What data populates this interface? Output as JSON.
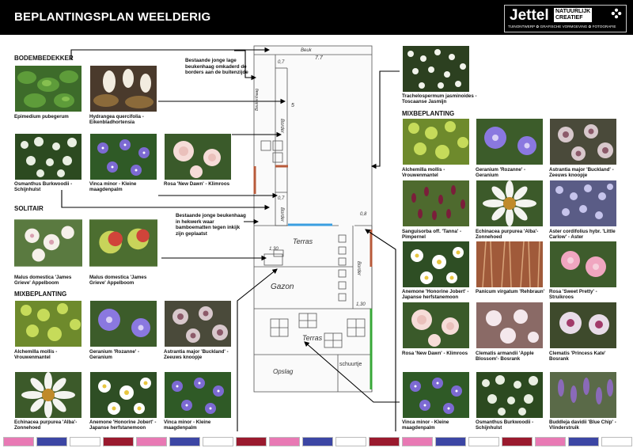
{
  "header": {
    "title": "BEPLANTINGSPLAN WEELDERIG",
    "logo_name": "Jettel",
    "logo_tag_line1": "NATUURLIJK",
    "logo_tag_line2": "CREATIEF",
    "logo_sub": "TUINONTWERP ✿ GRAFISCHE VORMGEVING ✿ FOTOGRAFIE"
  },
  "sections": {
    "ground": "BODEMBEDEKKER",
    "solitary": "SOLITAIR",
    "mix_left": "MIXBEPLANTING",
    "mix_right": "MIXBEPLANTING"
  },
  "notes": {
    "hedge_top": "Bestaande jonge lage beukenhaag omkaderd de borders aan de buitenzijde",
    "hedge_mid": "Bestaande jonge beukenhaag in hekwerk waar bamboematten tegen inkijk zijn geplaatst"
  },
  "plants": {
    "epimedium": "Epimedium pubegerum",
    "hydrangea": "Hydrangea quercifolia - Eikenbladhortensia",
    "osmanthus_l": "Osmanthus Burkwoodii - Schijnhulst",
    "vinca_l1": "Vinca minor - Kleine maagdenpalm",
    "rosa_dawn_l": "Rosa 'New Dawn' - Klimroos",
    "malus1": "Malus domestica 'James Grieve' Appelboom",
    "malus2": "Malus domestica 'James Grieve' Appelboom",
    "alch_l": "Alchemilla mollis - Vrouwenmantel",
    "gera_l": "Geranium 'Rozanne' - Geranium",
    "astr_l": "Astrantia major 'Buckland' - Zeeuws knoopje",
    "echi_l": "Echinacea purpurea 'Alba'- Zonnehoed",
    "anem_l": "Anemone 'Honorine Jobert' - Japanse herfstanemoon",
    "vinca_l2": "Vinca minor - Kleine maagdenpalm",
    "trach": "Trachelospermum jasminoides - Toscaanse Jasmijn",
    "alch_r": "Alchemilla mollis - Vrouwenmantel",
    "gera_r": "Geranium 'Rozanne' - Geranium",
    "astr_r": "Astrantia major 'Buckland' - Zeeuws knoopje",
    "sang": "Sanguisorba off. 'Tanna' - Pimpernel",
    "echi_r": "Echinacea purpurea 'Alba'- Zonnehoed",
    "aster": "Aster cordifolius hybr. 'Little Carlow' - Aster",
    "anem_r": "Anemone 'Honorine Jobert' - Japanse herfstanemoon",
    "pani": "Panicum virgatum 'Rehbraun'",
    "rosa_pretty": "Rosa 'Sweet Pretty' - Struikroos",
    "rosa_dawn_r": "Rosa 'New Dawn' - Klimroos",
    "clem_arm": "Clematis armandii 'Apple Blossom'- Bosrank",
    "clem_kate": "Clematis 'Princess Kate' Bosrank",
    "vinca_r": "Vinca minor - Kleine maagdenpalm",
    "osmanthus_r": "Osmanthus Burkwoodii - Schijnhulst",
    "buddleja": "Buddleja davidii 'Blue Chip' - Vlinderstruik"
  },
  "plan_labels": {
    "beuk_top": "Beuk",
    "dim_top": "7.7",
    "dim_07a": "0,7",
    "dim_5": "5",
    "dim_07b": "0,7",
    "dim_08": "0,8",
    "dim_130a": "1,30",
    "dim_130b": "1,30",
    "terras1": "Terras",
    "terras2": "Terras",
    "gazon": "Gazon",
    "opslag": "Opslag",
    "schuurtje": "schuurtje",
    "border_top": "Border",
    "border_right": "Border",
    "haag": "Beukenhaag",
    "border_left": "Border"
  },
  "colors": {
    "header_bg": "#000000",
    "swatch_pink": "#e879b4",
    "swatch_blue": "#3c46a4",
    "swatch_white": "#ffffff",
    "swatch_red": "#9a1a2e"
  },
  "swatches": [
    "#e879b4",
    "#3c46a4",
    "#ffffff",
    "#9a1a2e",
    "#e879b4",
    "#3c46a4",
    "#ffffff",
    "#9a1a2e",
    "#e879b4",
    "#3c46a4",
    "#ffffff",
    "#9a1a2e",
    "#e879b4",
    "#3c46a4",
    "#ffffff",
    "#9a1a2e",
    "#e879b4",
    "#3c46a4",
    "#ffffff"
  ]
}
